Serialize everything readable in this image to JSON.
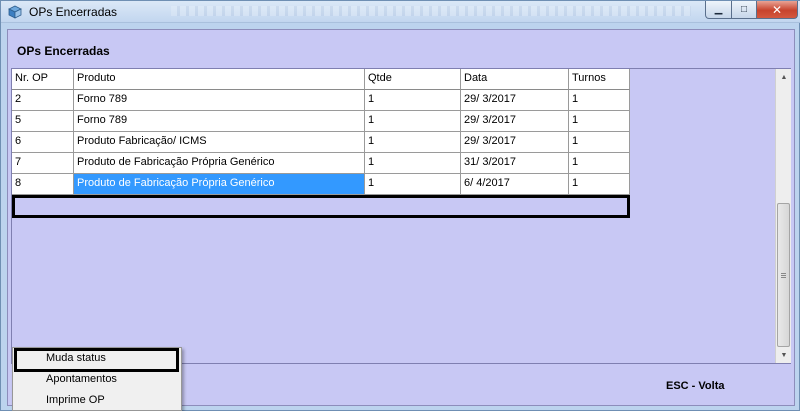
{
  "window": {
    "title": "OPs Encerradas",
    "close_glyph": "✕",
    "min_glyph": "▁",
    "max_glyph": "□"
  },
  "page": {
    "heading": "OPs Encerradas",
    "esc_hint": "ESC - Volta"
  },
  "grid": {
    "columns": [
      "Nr. OP",
      "Produto",
      "Qtde",
      "Data",
      "Turnos"
    ],
    "rows": [
      [
        "2",
        "Forno 789",
        "1",
        "29/ 3/2017",
        "1"
      ],
      [
        "5",
        "Forno 789",
        "1",
        "29/ 3/2017",
        "1"
      ],
      [
        "6",
        "Produto Fabricação/ ICMS",
        "1",
        "29/ 3/2017",
        "1"
      ],
      [
        "7",
        "Produto de Fabricação Própria Genérico",
        "1",
        "31/ 3/2017",
        "1"
      ],
      [
        "8",
        "Produto de Fabricação Própria Genérico",
        "1",
        "6/ 4/2017",
        "1"
      ]
    ],
    "selected_row": 4
  },
  "context_menu": {
    "items": [
      "Muda status",
      "Apontamentos",
      "Imprime OP"
    ],
    "highlighted": 0
  },
  "icons": {
    "app": "app-cube-icon",
    "scroll_up": "scroll-up-arrow-icon",
    "scroll_down": "scroll-down-arrow-icon"
  },
  "colors": {
    "client_bg": "#c8c8f4",
    "selection": "#3399ff",
    "titlebar": "#c2d6ef"
  }
}
